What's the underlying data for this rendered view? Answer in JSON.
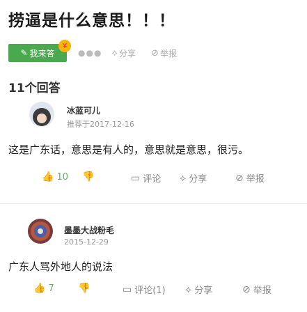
{
  "question": {
    "title": "捞逼是什么意思！！！",
    "answer_button": "我来答",
    "share": "分享",
    "report": "举报"
  },
  "answers_count": "11个回答",
  "answers": [
    {
      "user": "冰蓝可儿",
      "date_text": "推荐于2017-12-16",
      "text": "这是广东话，意思是有人的，意思就是意思，很污。",
      "like_count": "10",
      "comment": "评论",
      "share": "分享",
      "report": "举报"
    },
    {
      "user": "墨墨大战粉毛",
      "date_text": "2015-12-29",
      "text": "广东人骂外地人的说法",
      "like_count": "7",
      "comment": "评论(1)",
      "share": "分享",
      "report": "举报"
    }
  ],
  "colors": {
    "accent": "#4aa94f",
    "badge": "#ffb400"
  }
}
